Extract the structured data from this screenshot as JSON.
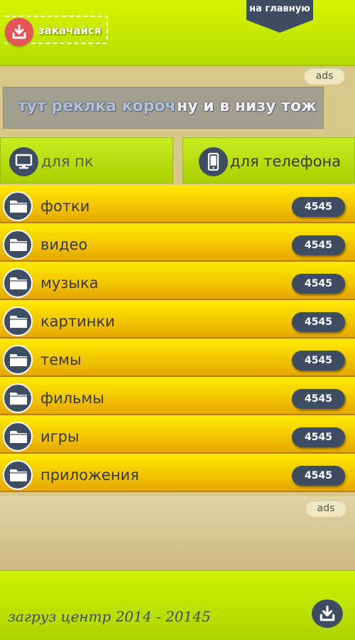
{
  "header": {
    "logo_label": "закачайся",
    "home_link": "на главную"
  },
  "ads": {
    "top_label": "ads",
    "bottom_label": "ads",
    "banner_text_left": "тут реклка короч",
    "banner_text_right": "ну и в низу тож"
  },
  "platform_tabs": [
    {
      "label": "для пк",
      "icon": "monitor-icon"
    },
    {
      "label": "для телефона",
      "icon": "phone-icon"
    }
  ],
  "categories": [
    {
      "label": "фотки",
      "count": "4545",
      "icon": "folder-icon"
    },
    {
      "label": "видео",
      "count": "4545",
      "icon": "folder-icon"
    },
    {
      "label": "музыка",
      "count": "4545",
      "icon": "folder-icon"
    },
    {
      "label": "картинки",
      "count": "4545",
      "icon": "folder-icon"
    },
    {
      "label": "темы",
      "count": "4545",
      "icon": "folder-icon"
    },
    {
      "label": "фильмы",
      "count": "4545",
      "icon": "folder-icon"
    },
    {
      "label": "игры",
      "count": "4545",
      "icon": "folder-icon"
    },
    {
      "label": "приложения",
      "count": "4545",
      "icon": "folder-icon"
    }
  ],
  "footer": {
    "text": "загруз центр 2014 - 20145",
    "icon": "download-icon"
  },
  "colors": {
    "lime": "#c9ec24",
    "yellow": "#f2c600",
    "navy": "#3f4d63",
    "red": "#e45656",
    "tan": "#d8c98a"
  }
}
